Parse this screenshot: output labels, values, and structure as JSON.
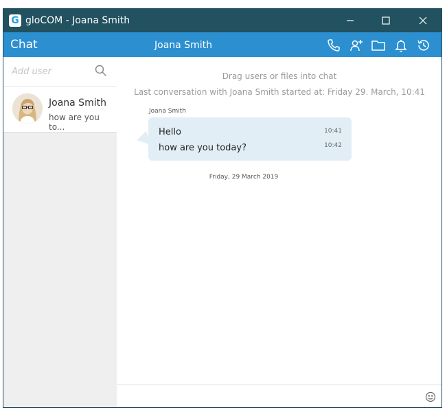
{
  "window": {
    "title": "gloCOM - Joana Smith",
    "app_icon_letter": "G"
  },
  "header": {
    "section_title": "Chat",
    "contact_name": "Joana Smith"
  },
  "sidebar": {
    "search_placeholder": "Add user",
    "contacts": [
      {
        "name": "Joana Smith",
        "preview": "how are you to..."
      }
    ]
  },
  "chat": {
    "drop_hint": "Drag users or files into chat",
    "last_conversation": "Last conversation with Joana Smith started at: Friday 29. March, 10:41",
    "sender": "Joana Smith",
    "messages": [
      {
        "text": "Hello",
        "time": "10:41"
      },
      {
        "text": "how are you today?",
        "time": "10:42"
      }
    ],
    "date_separator": "Friday, 29 March 2019"
  },
  "colors": {
    "titlebar": "#22515f",
    "header": "#2b8fd0",
    "bubble": "#e2eef6",
    "sidebar": "#efefef"
  },
  "icons": [
    "minimize-icon",
    "maximize-icon",
    "close-icon",
    "phone-icon",
    "add-user-icon",
    "folder-icon",
    "bell-icon",
    "history-icon",
    "search-icon",
    "emoji-icon"
  ]
}
